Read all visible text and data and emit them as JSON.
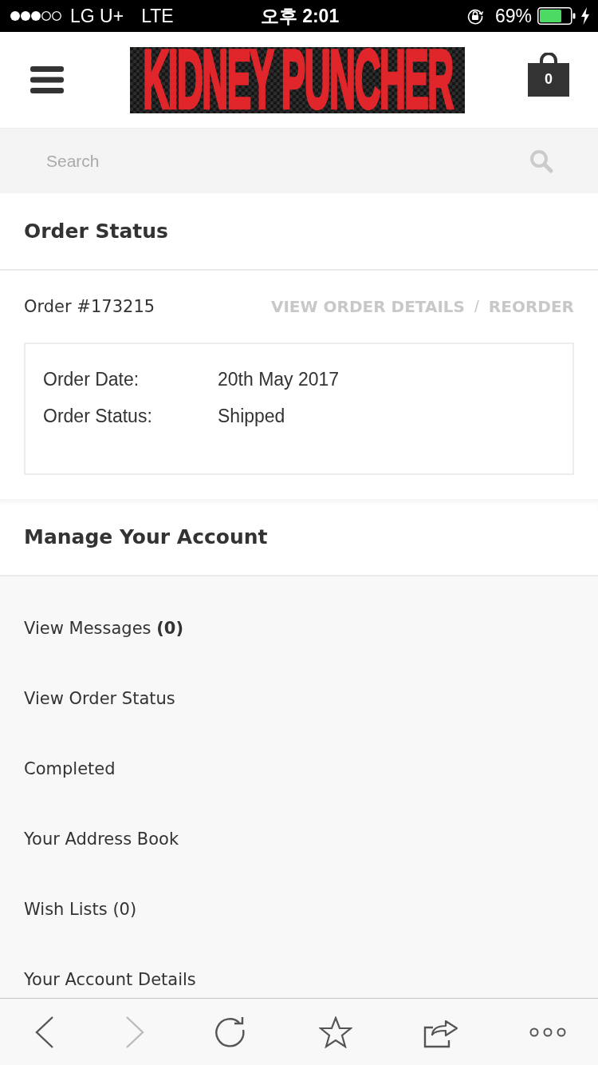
{
  "status_bar": {
    "carrier": "LG U+",
    "network": "LTE",
    "time": "오후 2:01",
    "battery": "69%"
  },
  "header": {
    "logo": "KIDNEY PUNCHER",
    "cart_count": "0"
  },
  "search": {
    "placeholder": "Search"
  },
  "order_section": {
    "title": "Order Status",
    "order_number": "Order #173215",
    "links": [
      "VIEW ORDER DETAILS",
      "REORDER"
    ],
    "separator": "/",
    "details": [
      {
        "label": "Order Date:",
        "value": "20th May 2017"
      },
      {
        "label": "Order Status:",
        "value": "Shipped"
      }
    ]
  },
  "account_section": {
    "title": "Manage Your Account",
    "items": [
      "View Messages **(0)**",
      "View Order Status",
      "Completed",
      "Your Address Book",
      "Wish Lists (0)",
      "Your Account Details"
    ]
  },
  "toolbar": [
    {
      "kind": "back",
      "disabled": false
    },
    {
      "kind": "forward",
      "disabled": true
    },
    {
      "kind": "reload",
      "disabled": false
    },
    {
      "kind": "bookmark",
      "disabled": false
    },
    {
      "kind": "share",
      "disabled": false
    },
    {
      "kind": "more",
      "disabled": false
    }
  ]
}
